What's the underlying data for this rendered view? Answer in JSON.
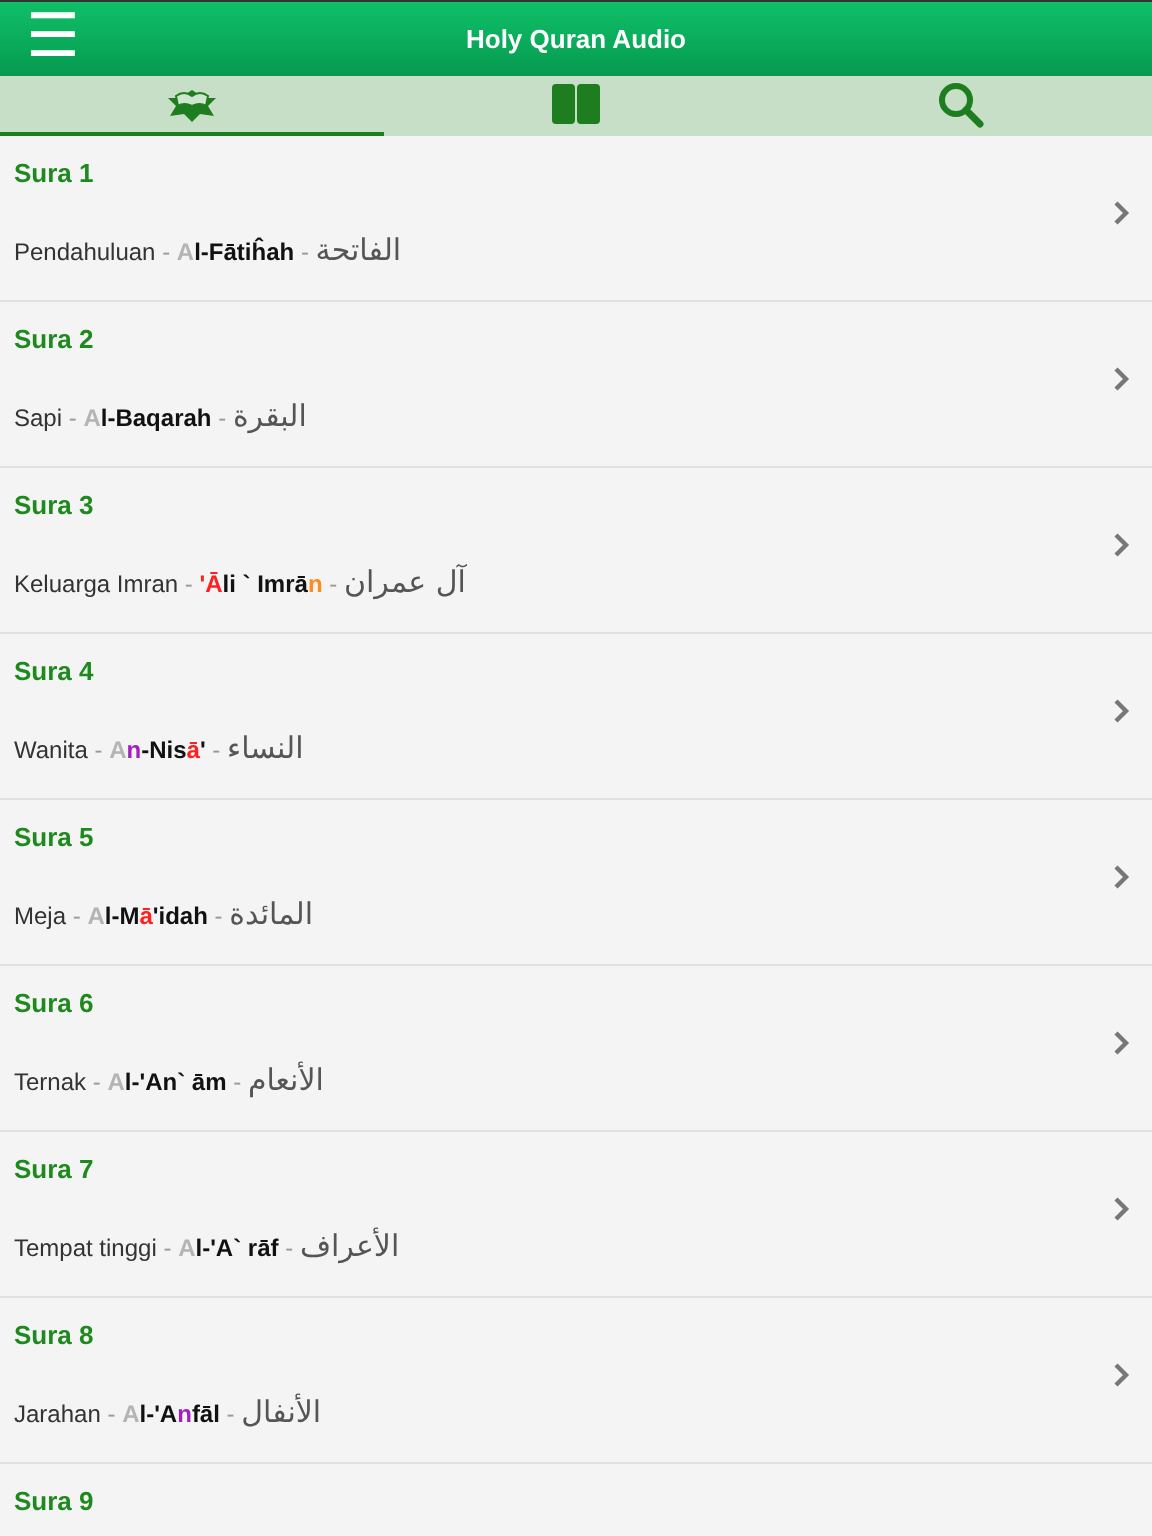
{
  "header": {
    "menu_icon": "☰",
    "title": "Holy Quran Audio"
  },
  "tabs": [
    {
      "kind": "quran",
      "selected": true
    },
    {
      "kind": "book",
      "selected": false
    },
    {
      "kind": "search",
      "selected": false
    }
  ],
  "suras": [
    {
      "title": "Sura 1",
      "meaning": "Pendahuluan",
      "name": [
        {
          "text": "A",
          "color": "#b4b4b4"
        },
        {
          "text": "l-Fātiĥah",
          "color": "#111111"
        }
      ],
      "arabic": "الفاتحة"
    },
    {
      "title": "Sura 2",
      "meaning": "Sapi",
      "name": [
        {
          "text": "A",
          "color": "#b4b4b4"
        },
        {
          "text": "l-Baqarah",
          "color": "#111111"
        }
      ],
      "arabic": "البقرة"
    },
    {
      "title": "Sura 3",
      "meaning": "Keluarga Imran",
      "name": [
        {
          "text": "'Ā",
          "color": "#ff2020"
        },
        {
          "text": "li ` Imrā",
          "color": "#111111"
        },
        {
          "text": "n",
          "color": "#ff8c1a"
        }
      ],
      "arabic": "آل عمران"
    },
    {
      "title": "Sura 4",
      "meaning": "Wanita",
      "name": [
        {
          "text": "A",
          "color": "#b4b4b4"
        },
        {
          "text": "n",
          "color": "#a020c0"
        },
        {
          "text": "-Nis",
          "color": "#111111"
        },
        {
          "text": "ā",
          "color": "#ff2020"
        },
        {
          "text": "'",
          "color": "#111111"
        }
      ],
      "arabic": "النساء"
    },
    {
      "title": "Sura 5",
      "meaning": "Meja",
      "name": [
        {
          "text": "A",
          "color": "#b4b4b4"
        },
        {
          "text": "l-M",
          "color": "#111111"
        },
        {
          "text": "ā",
          "color": "#ff2020"
        },
        {
          "text": "'idah",
          "color": "#111111"
        }
      ],
      "arabic": "المائدة"
    },
    {
      "title": "Sura 6",
      "meaning": "Ternak",
      "name": [
        {
          "text": "A",
          "color": "#b4b4b4"
        },
        {
          "text": "l-'An` ām",
          "color": "#111111"
        }
      ],
      "arabic": "الأنعام"
    },
    {
      "title": "Sura 7",
      "meaning": "Tempat tinggi",
      "name": [
        {
          "text": "A",
          "color": "#b4b4b4"
        },
        {
          "text": "l-'A` rāf",
          "color": "#111111"
        }
      ],
      "arabic": "الأعراف"
    },
    {
      "title": "Sura 8",
      "meaning": "Jarahan",
      "name": [
        {
          "text": "A",
          "color": "#b4b4b4"
        },
        {
          "text": "l-'A",
          "color": "#111111"
        },
        {
          "text": "n",
          "color": "#a020c0"
        },
        {
          "text": "fāl",
          "color": "#111111"
        }
      ],
      "arabic": "الأنفال"
    },
    {
      "title": "Sura 9"
    }
  ],
  "separator": "-"
}
